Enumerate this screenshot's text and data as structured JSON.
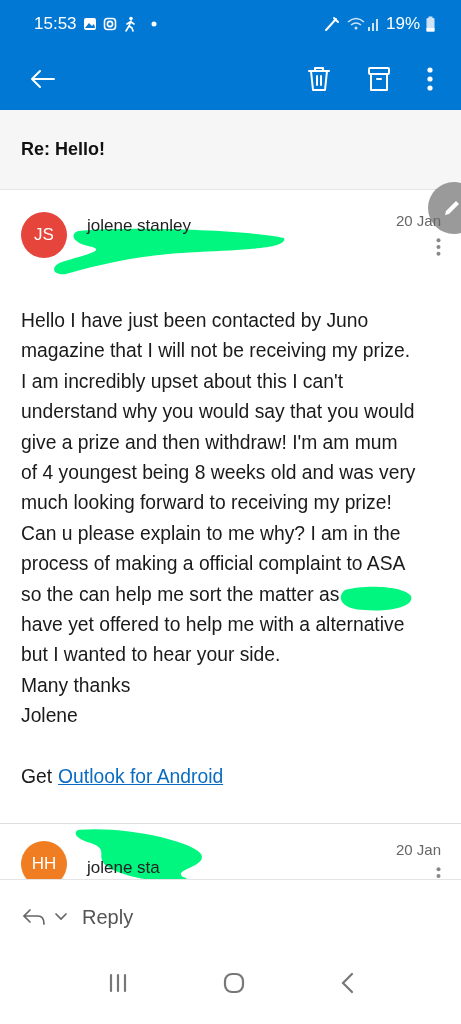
{
  "status_bar": {
    "time": "15:53",
    "battery": "19%"
  },
  "subject": "Re: Hello!",
  "messages": [
    {
      "initials": "JS",
      "color": "#e5453b",
      "sender": "jolene stanley",
      "date": "20 Jan",
      "expanded": true,
      "body_lines": [
        "Hello I have just been contacted by Juno",
        "magazine that I will not be receiving my prize.",
        "I am incredibly upset about this I can't",
        "understand why you would say that you would",
        "give a prize and then withdraw! I'm am mum",
        "of 4 youngest being 8 weeks old and was very",
        "much looking forward to receiving my prize!",
        "Can u please explain to me why? I am in the",
        "process of making a official complaint to ASA",
        "so the can help me sort the matter as",
        "have yet offered to help me with a alternative",
        "but I wanted to hear your side.",
        "Many thanks",
        "Jolene"
      ],
      "signature_prefix": "Get",
      "signature_link": "Outlook for Android"
    },
    {
      "initials": "HH",
      "color": "#f07d22",
      "sender": "jolene sta",
      "date": "20 Jan",
      "expanded": false
    }
  ],
  "reply_bar": {
    "label": "Reply"
  }
}
